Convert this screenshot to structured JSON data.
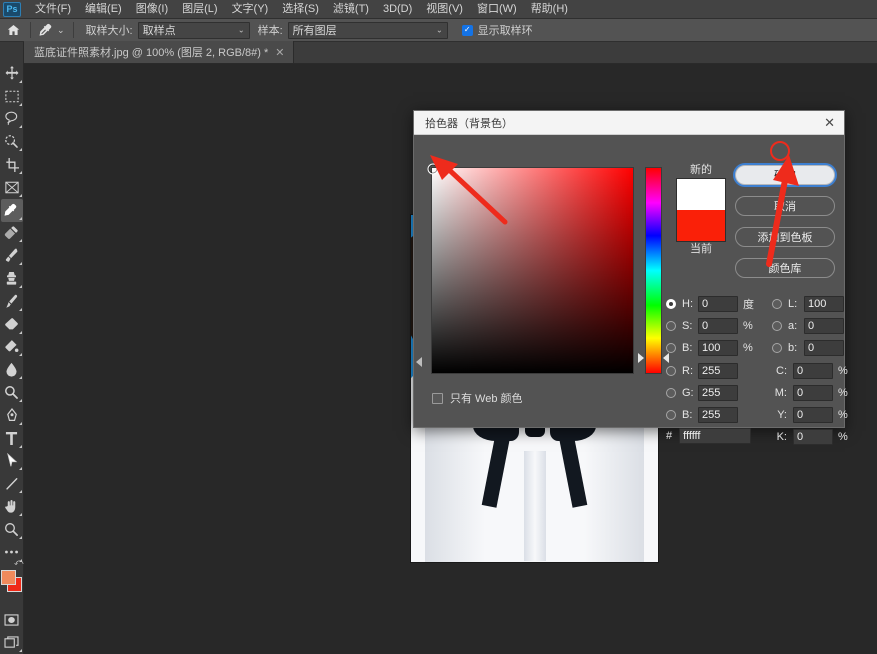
{
  "menu": {
    "logo": "Ps",
    "items": [
      {
        "label": "文件(F)"
      },
      {
        "label": "编辑(E)"
      },
      {
        "label": "图像(I)"
      },
      {
        "label": "图层(L)"
      },
      {
        "label": "文字(Y)"
      },
      {
        "label": "选择(S)"
      },
      {
        "label": "滤镜(T)"
      },
      {
        "label": "3D(D)"
      },
      {
        "label": "视图(V)"
      },
      {
        "label": "窗口(W)"
      },
      {
        "label": "帮助(H)"
      }
    ]
  },
  "options_bar": {
    "home_icon": "home-icon",
    "tool_icon": "eyedropper-icon",
    "sample_size_label": "取样大小:",
    "sample_size_value": "取样点",
    "sample_label": "样本:",
    "sample_value": "所有图层",
    "show_ring_label": "显示取样环",
    "show_ring_checked": true,
    "caret": "⌄",
    "check_glyph": "✓"
  },
  "document_tab": {
    "title": "蓝底证件照素材.jpg @ 100% (图层 2, RGB/8#) *",
    "close_glyph": "✕"
  },
  "toolbar": {
    "tools": [
      {
        "name": "move-tool"
      },
      {
        "name": "rectangular-marquee-tool"
      },
      {
        "name": "lasso-tool"
      },
      {
        "name": "quick-selection-tool"
      },
      {
        "name": "crop-tool"
      },
      {
        "name": "frame-tool"
      },
      {
        "name": "eyedropper-tool",
        "active": true
      },
      {
        "name": "spot-healing-brush-tool"
      },
      {
        "name": "brush-tool"
      },
      {
        "name": "clone-stamp-tool"
      },
      {
        "name": "history-brush-tool"
      },
      {
        "name": "eraser-tool"
      },
      {
        "name": "gradient-tool"
      },
      {
        "name": "blur-tool"
      },
      {
        "name": "dodge-tool"
      },
      {
        "name": "pen-tool"
      },
      {
        "name": "horizontal-type-tool"
      },
      {
        "name": "path-selection-tool"
      },
      {
        "name": "line-tool"
      },
      {
        "name": "hand-tool"
      },
      {
        "name": "zoom-tool"
      },
      {
        "name": "edit-toolbar-tool"
      }
    ],
    "foreground_color": "#f08a5c",
    "background_color": "#ef2a18",
    "quick_mask": "quick-mask-icon",
    "screen_mode": "screen-mode-icon"
  },
  "dialog": {
    "title": "拾色器（背景色）",
    "close_glyph": "✕",
    "preview": {
      "new_label": "新的",
      "current_label": "当前",
      "new_color": "#ffffff",
      "current_color": "#fa2008"
    },
    "buttons": [
      {
        "label": "确定",
        "primary": true
      },
      {
        "label": "取消",
        "primary": false
      },
      {
        "label": "添加到色板",
        "primary": false
      },
      {
        "label": "颜色库",
        "primary": false
      }
    ],
    "web_colors": {
      "label": "只有 Web 颜色",
      "checked": false
    },
    "fields": {
      "hsb": [
        {
          "key": "H",
          "label": "H:",
          "value": "0",
          "unit": "度",
          "selected": true
        },
        {
          "key": "S",
          "label": "S:",
          "value": "0",
          "unit": "%",
          "selected": false
        },
        {
          "key": "B",
          "label": "B:",
          "value": "100",
          "unit": "%",
          "selected": false
        }
      ],
      "lab": [
        {
          "key": "L",
          "label": "L:",
          "value": "100",
          "unit": "",
          "selected": false
        },
        {
          "key": "a",
          "label": "a:",
          "value": "0",
          "unit": "",
          "selected": false
        },
        {
          "key": "b",
          "label": "b:",
          "value": "0",
          "unit": "",
          "selected": false
        }
      ],
      "rgb": [
        {
          "key": "R",
          "label": "R:",
          "value": "255",
          "unit": "",
          "selected": false
        },
        {
          "key": "G",
          "label": "G:",
          "value": "255",
          "unit": "",
          "selected": false
        },
        {
          "key": "B",
          "label": "B:",
          "value": "255",
          "unit": "",
          "selected": false
        }
      ],
      "cmyk": [
        {
          "key": "C",
          "label": "C:",
          "value": "0",
          "unit": "%"
        },
        {
          "key": "M",
          "label": "M:",
          "value": "0",
          "unit": "%"
        },
        {
          "key": "Y",
          "label": "Y:",
          "value": "0",
          "unit": "%"
        },
        {
          "key": "K",
          "label": "K:",
          "value": "0",
          "unit": "%"
        }
      ],
      "hex": {
        "label": "#",
        "value": "ffffff"
      }
    },
    "picker": {
      "hue_degrees": 0,
      "saturation": 0,
      "brightness": 100,
      "selected_hex": "#ffffff"
    }
  },
  "annotations": {
    "accent_color": "#ee2b1c",
    "arrow_to_picker_corner": "arrow-annotation",
    "arrow_to_ok_button": "arrow-annotation",
    "circle_on_ok_button": "circle-annotation"
  },
  "canvas": {
    "image_name": "blue-background-id-photo",
    "background_color": "#1f93e0"
  }
}
